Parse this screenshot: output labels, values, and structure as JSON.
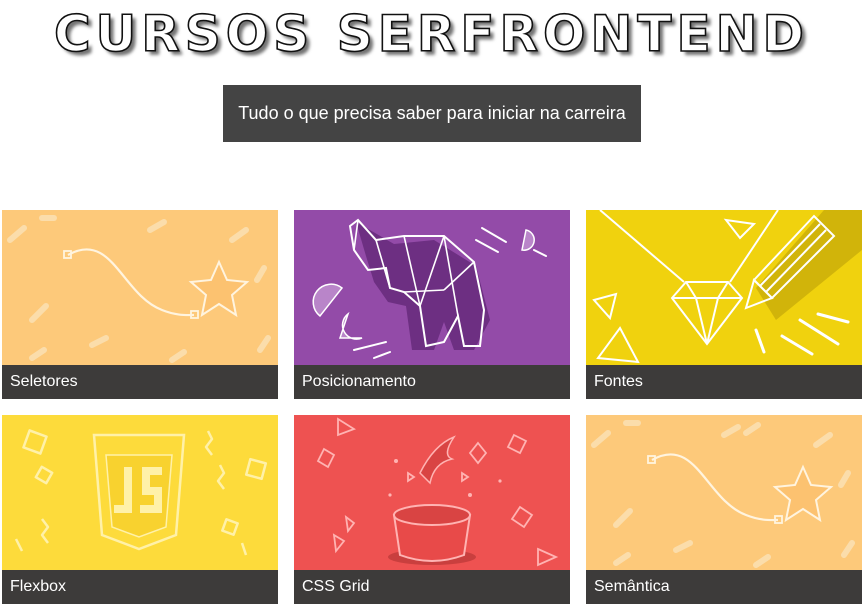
{
  "header": {
    "title": "CURSOS SERFRONTEND",
    "subtitle": "Tudo o que precisa saber para iniciar na carreira"
  },
  "courses": [
    {
      "label": "Seletores",
      "color": "#fdc97a",
      "icon": "curve-star-icon"
    },
    {
      "label": "Posicionamento",
      "color": "#934ba8",
      "icon": "origami-elephant-icon"
    },
    {
      "label": "Fontes",
      "color": "#f0d20e",
      "icon": "diamond-pencil-icon"
    },
    {
      "label": "Flexbox",
      "color": "#fddb3b",
      "icon": "js-shield-icon"
    },
    {
      "label": "CSS Grid",
      "color": "#ee5251",
      "icon": "magic-hat-bird-icon"
    },
    {
      "label": "Semântica",
      "color": "#fdc97a",
      "icon": "curve-star-icon"
    }
  ],
  "caption_color": "#3d3b3a"
}
